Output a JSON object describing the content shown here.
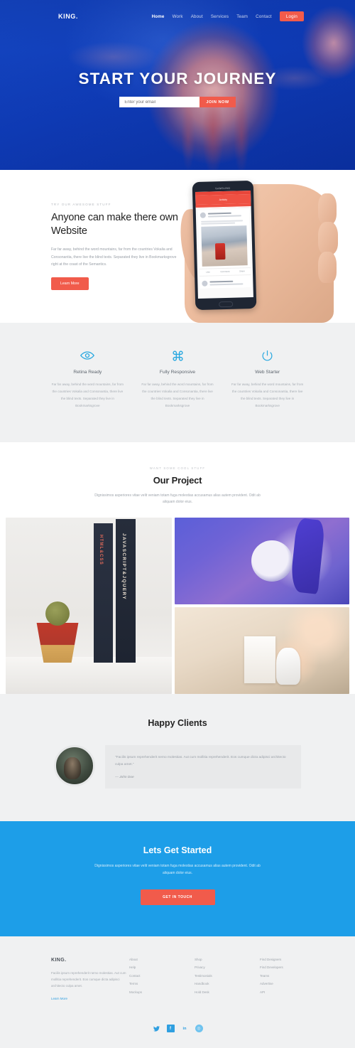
{
  "header": {
    "brand": "KING.",
    "nav": [
      {
        "label": "Home",
        "active": true
      },
      {
        "label": "Work",
        "active": false
      },
      {
        "label": "About",
        "active": false
      },
      {
        "label": "Services",
        "active": false
      },
      {
        "label": "Team",
        "active": false
      },
      {
        "label": "Contact",
        "active": false
      }
    ],
    "login_label": "Login"
  },
  "hero": {
    "title": "START YOUR JOURNEY",
    "email_placeholder": "Enter your email",
    "email_value": "",
    "submit_label": "JOIN NOW"
  },
  "about": {
    "eyebrow": "TRY OUR AWESOME STUFF",
    "heading": "Anyone can make there own Website",
    "paragraph": "Far far away, behind the word mountains, far from the countries Vokalia and Consonantia, there live the blind texts. Separated they live in Bookmarksgrove right at the coast of the Semantics.",
    "button_label": "Learn More",
    "phone": {
      "brand": "SAMSUNG",
      "app_title": "Activity",
      "post_author": "Alexander Jones",
      "post_meta": "Melbourne, AU  ·  5 hours ago",
      "post_text": "Lorem ipsum dolor sit amet, consectetur adipiscing elit, sed do eiusmod tempor incididunt.",
      "actions": [
        "Like",
        "Comment",
        "Share"
      ],
      "second_author": "Gabriella Becker"
    }
  },
  "features": {
    "items": [
      {
        "icon": "eye-icon",
        "title": "Retina Ready",
        "desc": "Far far away, behind the word mountains, far from the countries Vokalia and Consonantia, there live the blind texts. Separated they live in Bookmarksgrove"
      },
      {
        "icon": "command-icon",
        "title": "Fully Responsive",
        "desc": "Far far away, behind the word mountains, far from the countries Vokalia and Consonantia, there live the blind texts. Separated they live in Bookmarksgrove"
      },
      {
        "icon": "power-icon",
        "title": "Web Starter",
        "desc": "Far far away, behind the word mountains, far from the countries Vokalia and Consonantia, there live the blind texts. Separated they live in Bookmarksgrove"
      }
    ]
  },
  "project": {
    "eyebrow": "WANT SOME COOL STUFF",
    "title": "Our Project",
    "subtitle": "Dignissimos asperiores vitae velit veniam totam fuga molestias accusamus alias autem provident. Odit ab aliquam dolor eius.",
    "gallery": [
      {
        "name": "cactus-and-books",
        "caption_1": "HTML&CSS",
        "caption_2": "JAVASCRIPT&JQUERY"
      },
      {
        "name": "concert-stage"
      },
      {
        "name": "stormtrooper-desk"
      }
    ]
  },
  "clients": {
    "title": "Happy Clients",
    "quote": "\"Facilis ipsum reprehenderit nemo molestias. Aut cum mollitia reprehenderit. Eos cumque dicta adipisci architecto culpa amet.\"",
    "author": "— John Doe"
  },
  "cta": {
    "title": "Lets Get Started",
    "subtitle": "Dignissimos asperiores vitae velit veniam totam fuga molestias accusamus alias autem provident. Odit ab aliquam dolor eius.",
    "button_label": "GET IN TOUCH"
  },
  "footer": {
    "logo": "KING.",
    "description": "Facilis ipsum reprehenderit nemo molestias. Aut cum mollitia reprehenderit. Eos cumque dicta adipisci architecto culpa amet.",
    "learn_more": "Learn More",
    "columns": [
      {
        "links": [
          "About",
          "Help",
          "Contact",
          "Terms",
          "Mockups"
        ]
      },
      {
        "links": [
          "Shop",
          "Privacy",
          "Testimonials",
          "Handbook",
          "Hold Desk"
        ]
      },
      {
        "links": [
          "Find Designers",
          "Find Developers",
          "Teams",
          "Advertise",
          "API"
        ]
      }
    ],
    "socials": [
      {
        "name": "twitter-icon",
        "glyph": "✉"
      },
      {
        "name": "facebook-icon",
        "glyph": "f"
      },
      {
        "name": "linkedin-icon",
        "glyph": "in"
      },
      {
        "name": "instagram-icon",
        "glyph": "◎"
      }
    ]
  },
  "colors": {
    "accent_red": "#f15b4b",
    "accent_blue": "#1d9ee8",
    "icon_blue": "#29a8e0",
    "hero_blue": "#0f3cb8",
    "muted_gray": "#f0f1f2"
  }
}
